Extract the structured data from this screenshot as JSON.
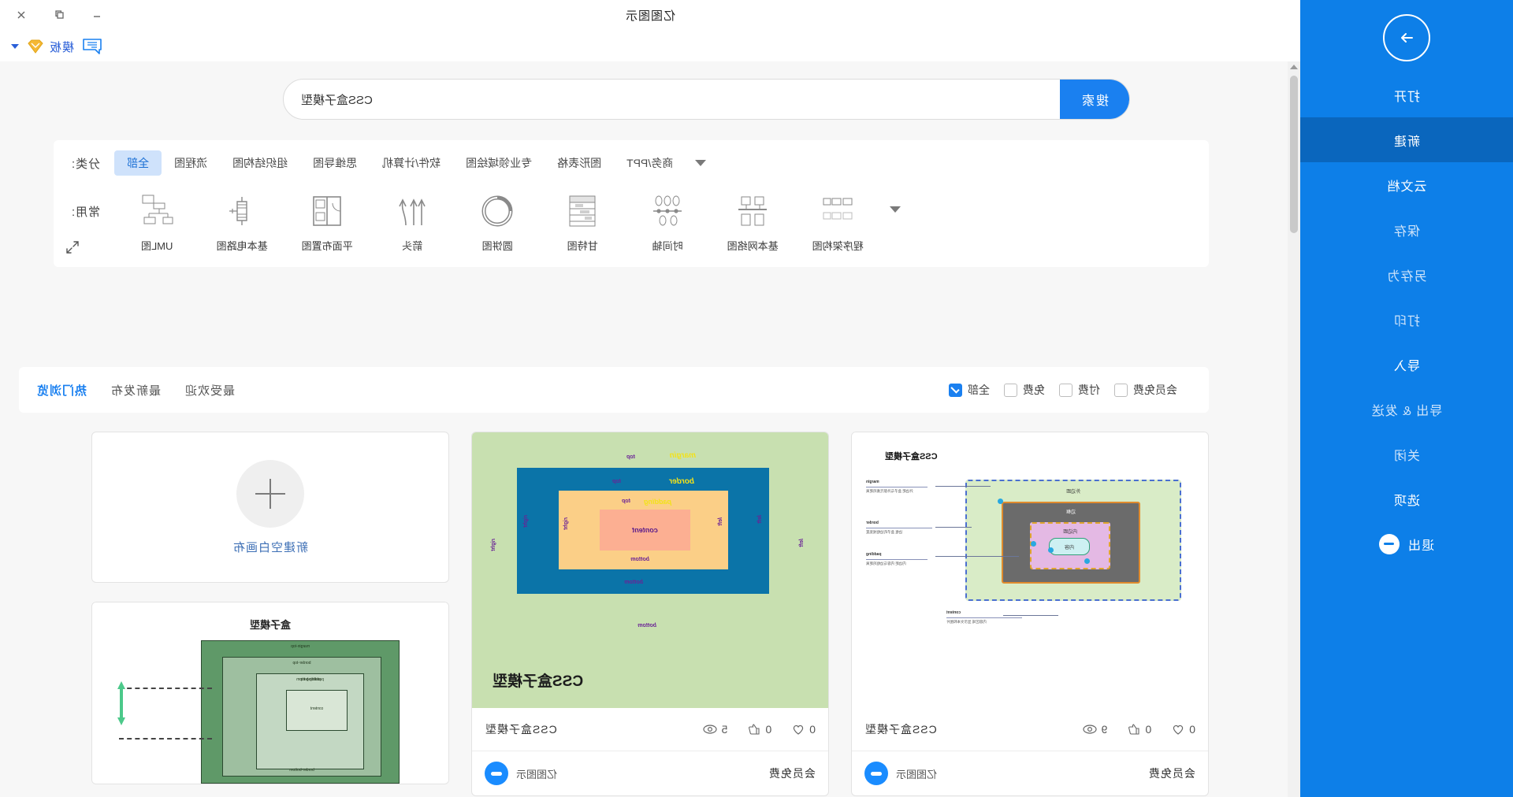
{
  "window": {
    "title": "亿图图示",
    "controls": [
      "minimize",
      "restore",
      "close"
    ]
  },
  "tabbar": {
    "template_tab_label": "模板",
    "doc_icon": "document-icon",
    "diamond_icon": "diamond-icon",
    "caret_icon": "chevron-down-icon"
  },
  "search": {
    "value": "CSS盒子模型",
    "placeholder": "CSS盒子模型",
    "button_label": "搜索"
  },
  "filters": {
    "category_label": "分类:",
    "categories": [
      {
        "label": "全部",
        "active": true
      },
      {
        "label": "流程图",
        "active": false
      },
      {
        "label": "组织结构图",
        "active": false
      },
      {
        "label": "思维导图",
        "active": false
      },
      {
        "label": "软件/计算机",
        "active": false
      },
      {
        "label": "专业领域绘图",
        "active": false
      },
      {
        "label": "图形表格",
        "active": false
      },
      {
        "label": "商务/PPT",
        "active": false
      }
    ],
    "common_label": "常用:",
    "common_items": [
      {
        "label": "UML图",
        "icon": "uml-diagram-icon"
      },
      {
        "label": "基本电路图",
        "icon": "circuit-diagram-icon"
      },
      {
        "label": "平面布置图",
        "icon": "floor-plan-icon"
      },
      {
        "label": "箭头",
        "icon": "arrow-icon"
      },
      {
        "label": "圆饼图",
        "icon": "pie-chart-icon"
      },
      {
        "label": "甘特图",
        "icon": "gantt-chart-icon"
      },
      {
        "label": "时间轴",
        "icon": "timeline-icon"
      },
      {
        "label": "基本网络图",
        "icon": "network-diagram-icon"
      },
      {
        "label": "程序架构图",
        "icon": "program-architecture-icon"
      }
    ],
    "expand_icon": "chevron-down-icon",
    "fullscreen_icon": "expand-arrows-icon"
  },
  "sortbar": {
    "tabs": [
      {
        "label": "热门浏览",
        "active": true
      },
      {
        "label": "最新发布",
        "active": false
      },
      {
        "label": "最受欢迎",
        "active": false
      }
    ],
    "checkboxes": [
      {
        "label": "全部",
        "checked": true
      },
      {
        "label": "免费",
        "checked": false
      },
      {
        "label": "付费",
        "checked": false
      },
      {
        "label": "会员免费",
        "checked": false
      }
    ]
  },
  "sidebar": {
    "back_icon": "arrow-right-circle-icon",
    "items": [
      {
        "label": "打开",
        "state": "normal"
      },
      {
        "label": "新建",
        "state": "active"
      },
      {
        "label": "云文档",
        "state": "normal"
      },
      {
        "label": "保存",
        "state": "dim"
      },
      {
        "label": "另存为",
        "state": "dim"
      },
      {
        "label": "打印",
        "state": "dim"
      },
      {
        "label": "导入",
        "state": "normal"
      },
      {
        "label": "导出 & 发送",
        "state": "dim"
      },
      {
        "label": "关闭",
        "state": "dim"
      },
      {
        "label": "选项",
        "state": "normal"
      },
      {
        "label": "退出",
        "state": "exit",
        "icon": "minus-circle-icon"
      }
    ]
  },
  "blank_canvas": {
    "label": "新建空白画布",
    "icon": "plus-icon"
  },
  "cards": [
    {
      "title": "CSS盒子模型",
      "views": "9",
      "likes": "0",
      "favorites": "0",
      "author": "亿图图示",
      "price": "会员免费",
      "thumb_title": "CSS盒子模型",
      "thumb_layers": [
        "边框",
        "内边距",
        "内容",
        "外边距"
      ]
    },
    {
      "title": "CSS盒子模型",
      "views": "5",
      "likes": "0",
      "favorites": "0",
      "author": "亿图图示",
      "price": "会员免费",
      "thumb_title": "CSS盒子模型",
      "thumb_labels": {
        "margin": "margin",
        "border": "border",
        "padding": "padding",
        "content": "content",
        "top": "top",
        "bottom": "bottom",
        "left": "left",
        "right": "right"
      }
    },
    {
      "title": "盒子模型",
      "thumb_title": "盒子模型",
      "thumb_labels": {
        "margin_top": "margin-top",
        "border_top": "border-top",
        "padding_top": "padding-top",
        "content": "content",
        "padding_bottom": "padding-bottom",
        "border_bottom": "border-bottom"
      }
    }
  ],
  "icons": {
    "eye": "eye-icon",
    "thumbup": "thumbs-up-icon",
    "heart": "heart-icon"
  },
  "colors": {
    "accent": "#1a80f0",
    "sidebar": "#0d7fe8",
    "sidebar_active": "#0a66bd",
    "chip_active_bg": "#cfe2fb",
    "page_bg": "#f7f7f7"
  }
}
